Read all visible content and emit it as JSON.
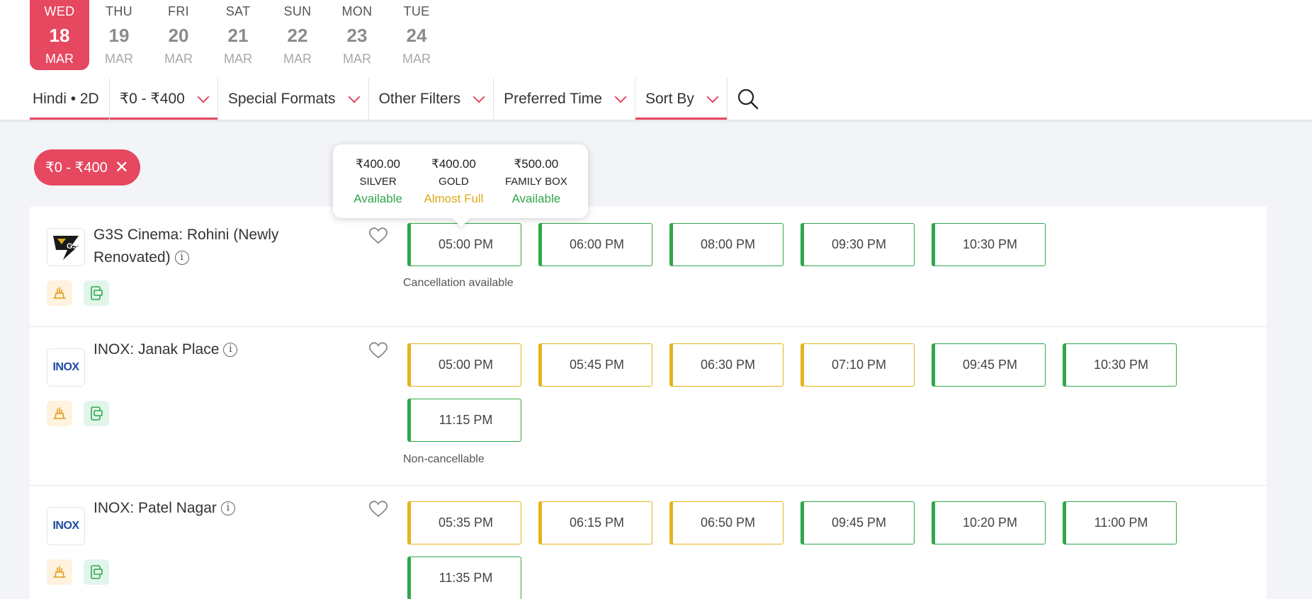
{
  "dates": [
    {
      "day": "WED",
      "num": "18",
      "month": "MAR",
      "active": true
    },
    {
      "day": "THU",
      "num": "19",
      "month": "MAR"
    },
    {
      "day": "FRI",
      "num": "20",
      "month": "MAR"
    },
    {
      "day": "SAT",
      "num": "21",
      "month": "MAR"
    },
    {
      "day": "SUN",
      "num": "22",
      "month": "MAR"
    },
    {
      "day": "MON",
      "num": "23",
      "month": "MAR"
    },
    {
      "day": "TUE",
      "num": "24",
      "month": "MAR"
    }
  ],
  "filters": {
    "language": "Hindi • 2D",
    "price": "₹0 - ₹400",
    "special_formats": "Special Formats",
    "other_filters": "Other Filters",
    "preferred_time": "Preferred Time",
    "sort_by": "Sort By"
  },
  "active_chip": "₹0 - ₹400",
  "tooltip": [
    {
      "price": "₹400.00",
      "category": "SILVER",
      "status": "Available",
      "status_color": "#2fa74b"
    },
    {
      "price": "₹400.00",
      "category": "GOLD",
      "status": "Almost Full",
      "status_color": "#e0a918"
    },
    {
      "price": "₹500.00",
      "category": "FAMILY BOX",
      "status": "Available",
      "status_color": "#2fa74b"
    }
  ],
  "cinemas": [
    {
      "name": "G3S Cinema: Rohini (Newly Renovated)",
      "logo": "g3s-logo",
      "note": "Cancellation available",
      "times": [
        {
          "t": "05:00 PM",
          "status": "green"
        },
        {
          "t": "06:00 PM",
          "status": "green"
        },
        {
          "t": "08:00 PM",
          "status": "green"
        },
        {
          "t": "09:30 PM",
          "status": "green"
        },
        {
          "t": "10:30 PM",
          "status": "green"
        }
      ]
    },
    {
      "name": "INOX: Janak Place",
      "logo": "INOX",
      "note": "Non-cancellable",
      "times": [
        {
          "t": "05:00 PM",
          "status": "yellow"
        },
        {
          "t": "05:45 PM",
          "status": "yellow"
        },
        {
          "t": "06:30 PM",
          "status": "yellow"
        },
        {
          "t": "07:10 PM",
          "status": "yellow"
        },
        {
          "t": "09:45 PM",
          "status": "green"
        },
        {
          "t": "10:30 PM",
          "status": "green"
        },
        {
          "t": "11:15 PM",
          "status": "green"
        }
      ]
    },
    {
      "name": "INOX: Patel Nagar",
      "logo": "INOX",
      "note": "",
      "times": [
        {
          "t": "05:35 PM",
          "status": "yellow"
        },
        {
          "t": "06:15 PM",
          "status": "yellow"
        },
        {
          "t": "06:50 PM",
          "status": "yellow"
        },
        {
          "t": "09:45 PM",
          "status": "green"
        },
        {
          "t": "10:20 PM",
          "status": "green"
        },
        {
          "t": "11:00 PM",
          "status": "green"
        },
        {
          "t": "11:35 PM",
          "status": "green"
        }
      ]
    }
  ],
  "colors": {
    "accent": "#e5485f",
    "available": "#2fa74b",
    "almost_full": "#e5b31d"
  }
}
